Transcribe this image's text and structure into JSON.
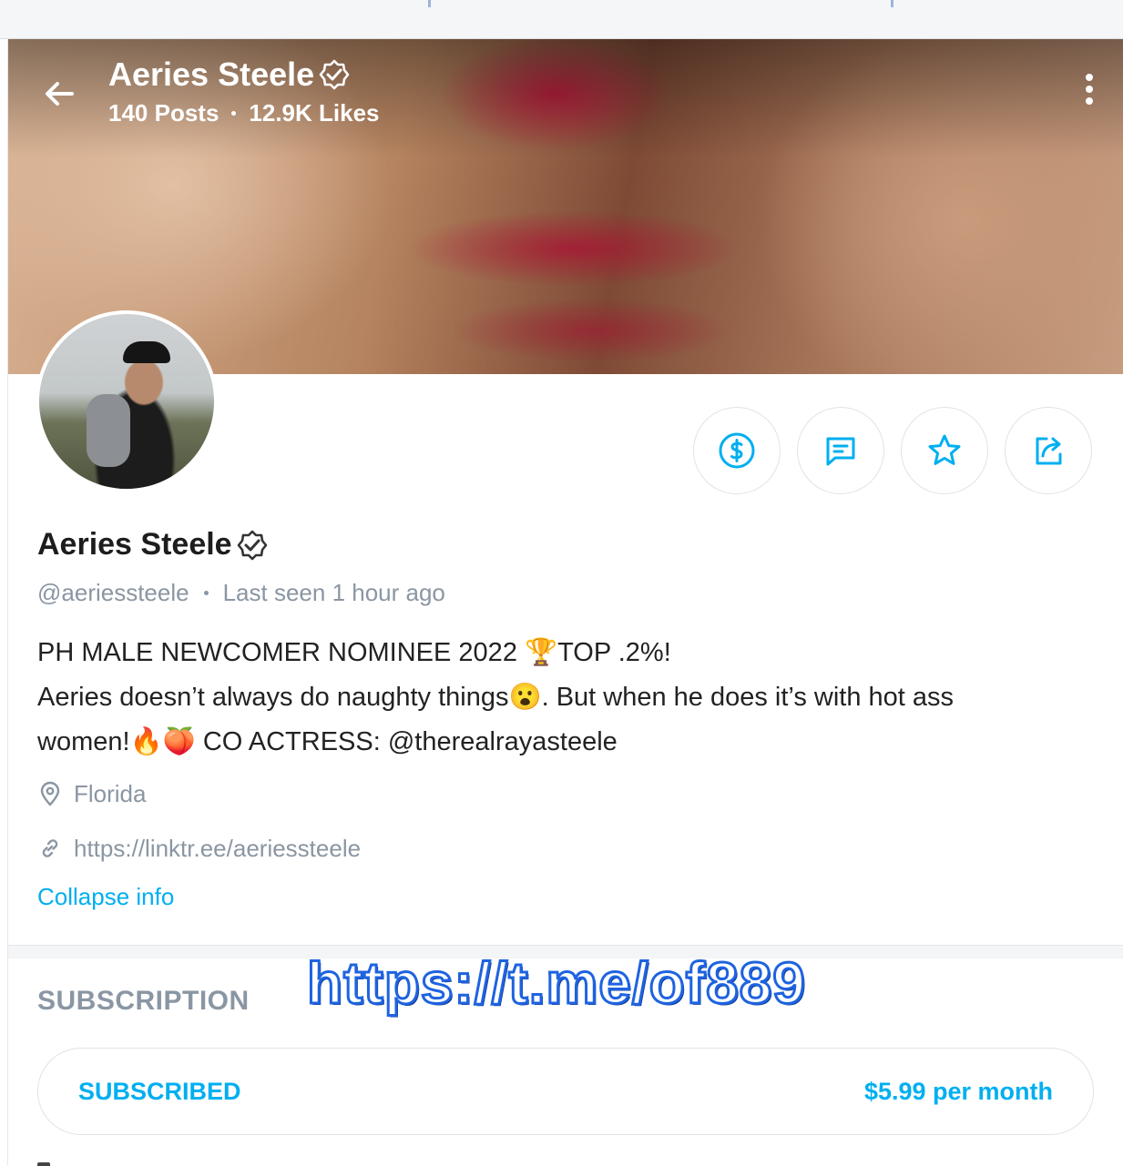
{
  "header": {
    "name": "Aeries Steele",
    "posts": "140 Posts",
    "likes": "12.9K Likes"
  },
  "profile": {
    "name": "Aeries Steele",
    "handle": "@aeriessteele",
    "last_seen": "Last seen 1 hour ago",
    "bio_line1": "PH MALE NEWCOMER NOMINEE 2022 🏆TOP .2%!",
    "bio_line2": "Aeries doesn’t always do naughty things😮. But when he does it’s with hot ass",
    "bio_line3": "women!🔥🍑 CO ACTRESS: @therealrayasteele",
    "location": "Florida",
    "website": "https://linktr.ee/aeriessteele",
    "collapse_label": "Collapse info"
  },
  "subscription": {
    "heading": "SUBSCRIPTION",
    "status": "SUBSCRIBED",
    "price": "$5.99 per month"
  },
  "watermark": "https://t.me/of889",
  "icons": {
    "back": "arrow-left-icon",
    "verified": "verified-badge-icon",
    "more": "kebab-menu-icon",
    "tip": "dollar-circle-icon",
    "message": "message-icon",
    "favorite": "star-icon",
    "share": "share-icon",
    "location": "map-pin-icon",
    "link": "link-icon"
  },
  "colors": {
    "accent": "#00aff0",
    "muted": "#8a96a3",
    "watermark_stroke": "#1e63e0"
  }
}
